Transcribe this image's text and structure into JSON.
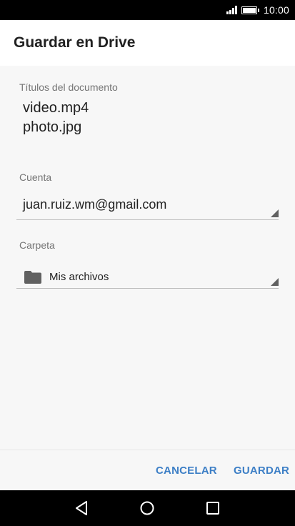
{
  "status_bar": {
    "time": "10:00",
    "icons": [
      "signal-icon",
      "battery-icon"
    ]
  },
  "dialog": {
    "title": "Guardar en Drive"
  },
  "documents": {
    "label": "Títulos del documento",
    "items": [
      "video.mp4",
      "photo.jpg"
    ]
  },
  "account": {
    "label": "Cuenta",
    "value": "juan.ruiz.wm@gmail.com"
  },
  "folder": {
    "label": "Carpeta",
    "value": "Mis archivos",
    "icon": "folder-icon"
  },
  "actions": {
    "cancel_label": "CANCELAR",
    "save_label": "GUARDAR"
  },
  "navigation": {
    "icons": [
      "back-icon",
      "home-icon",
      "recents-icon"
    ]
  },
  "colors": {
    "accent": "#3d7fc6",
    "background": "#f7f7f7",
    "header": "#ffffff",
    "system_bars": "#000000"
  }
}
